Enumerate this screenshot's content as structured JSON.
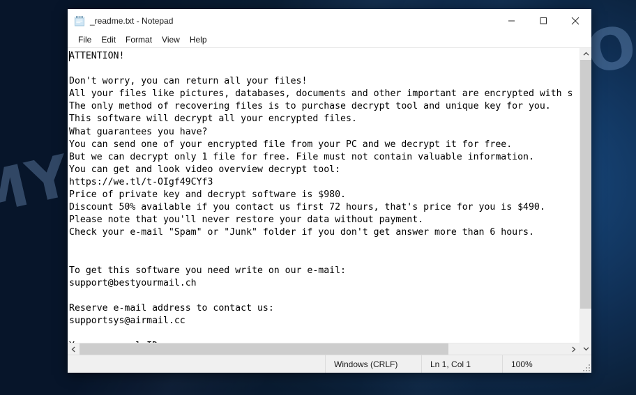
{
  "desktop": {
    "watermark": "MYANTISPYWARE.COM",
    "background_color": "#0c1c2e",
    "accent_color": "#1d4c84"
  },
  "window": {
    "title": "_readme.txt - Notepad",
    "icon": "notepad-icon",
    "controls": {
      "minimize": "minimize-icon",
      "maximize": "maximize-icon",
      "close": "close-icon"
    }
  },
  "menubar": {
    "items": [
      {
        "label": "File"
      },
      {
        "label": "Edit"
      },
      {
        "label": "Format"
      },
      {
        "label": "View"
      },
      {
        "label": "Help"
      }
    ]
  },
  "editor": {
    "content": "ATTENTION!\n\nDon't worry, you can return all your files!\nAll your files like pictures, databases, documents and other important are encrypted with s\nThe only method of recovering files is to purchase decrypt tool and unique key for you.\nThis software will decrypt all your encrypted files.\nWhat guarantees you have?\nYou can send one of your encrypted file from your PC and we decrypt it for free.\nBut we can decrypt only 1 file for free. File must not contain valuable information.\nYou can get and look video overview decrypt tool:\nhttps://we.tl/t-OIgf49CYf3\nPrice of private key and decrypt software is $980.\nDiscount 50% available if you contact us first 72 hours, that's price for you is $490.\nPlease note that you'll never restore your data without payment.\nCheck your e-mail \"Spam\" or \"Junk\" folder if you don't get answer more than 6 hours.\n\n\nTo get this software you need write on our e-mail:\nsupport@bestyourmail.ch\n\nReserve e-mail address to contact us:\nsupportsys@airmail.cc\n\nYour personal ID:",
    "scrollbars": {
      "vertical_arrow_up": "chevron-up-icon",
      "vertical_arrow_down": "chevron-down-icon",
      "horizontal_arrow_left": "chevron-left-icon",
      "horizontal_arrow_right": "chevron-right-icon"
    }
  },
  "statusbar": {
    "encoding": "Windows (CRLF)",
    "line_col": "Ln 1, Col 1",
    "zoom": "100%"
  }
}
